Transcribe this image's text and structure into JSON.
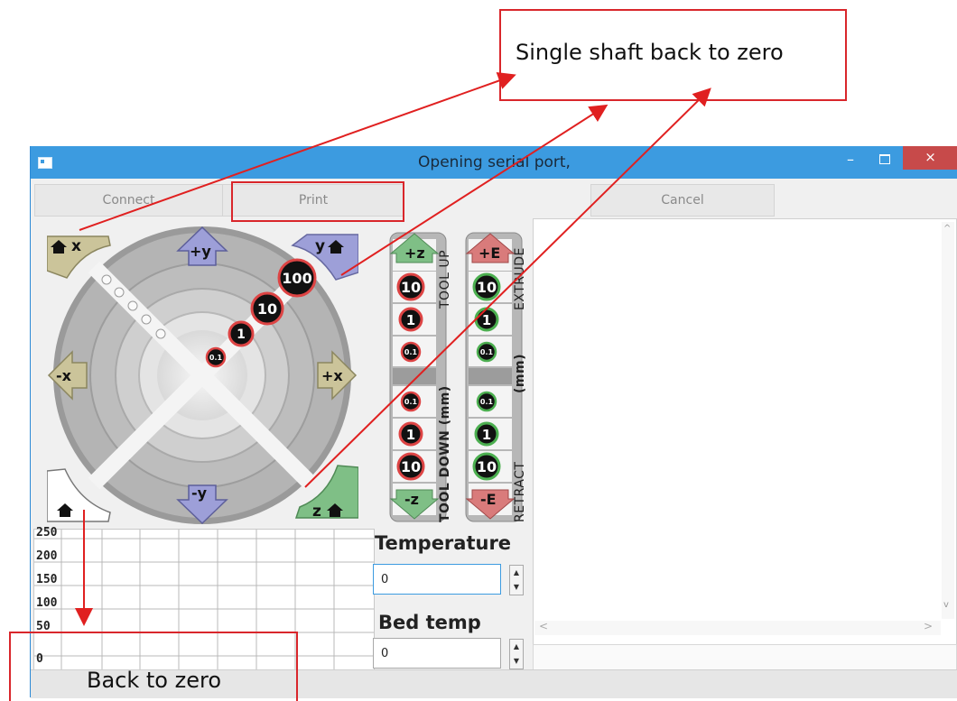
{
  "annotations": {
    "top_callout": "Single shaft back to zero",
    "bottom_callout": "Back to zero"
  },
  "window": {
    "title": "Opening serial port,",
    "minimize": "–",
    "close": "×"
  },
  "toolbar": {
    "connect_label": "Connect",
    "print_label": "Print",
    "cancel_label": "Cancel"
  },
  "jog": {
    "home_x": "x",
    "home_y": "y",
    "home_z": "z",
    "plus_y": "+y",
    "minus_y": "-y",
    "plus_x": "+x",
    "minus_x": "-x",
    "steps": [
      "100",
      "10",
      "1",
      "0.1"
    ]
  },
  "z_column": {
    "up_label": "+z",
    "down_label": "-z",
    "tool_up": "TOOL UP",
    "tool_down": "TOOL DOWN (mm)",
    "up_steps": [
      "10",
      "1",
      "0.1"
    ],
    "down_steps": [
      "0.1",
      "1",
      "10"
    ]
  },
  "e_column": {
    "extrude_label": "+E",
    "retract_label": "-E",
    "extrude": "EXTRUDE",
    "retract": "RETRACT",
    "mm": "(mm)",
    "extrude_steps": [
      "10",
      "1",
      "0.1"
    ],
    "retract_steps": [
      "0.1",
      "1",
      "10"
    ]
  },
  "graph": {
    "y_labels": [
      "250",
      "200",
      "150",
      "100",
      "50",
      "0"
    ]
  },
  "temperature": {
    "heading": "Temperature",
    "value": "0"
  },
  "bed": {
    "heading": "Bed temp",
    "value": "0"
  },
  "colors": {
    "titlebar": "#3c9be0",
    "annotation": "#d9262b",
    "x_button": "#cbc49a",
    "y_button": "#9d9fd8",
    "z_button": "#7fbf86",
    "e_button": "#d97b7b"
  }
}
